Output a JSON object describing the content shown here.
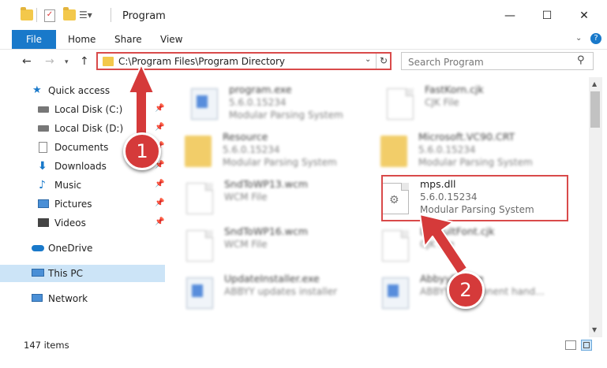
{
  "window": {
    "title": "Program",
    "minimize": "—",
    "maximize": "☐",
    "close": "✕"
  },
  "ribbon": {
    "tabs": [
      "File",
      "Home",
      "Share",
      "View"
    ],
    "help": "?"
  },
  "address": {
    "path": "C:\\Program Files\\Program Directory"
  },
  "search": {
    "placeholder": "Search Program"
  },
  "sidebar": {
    "items": [
      {
        "label": "Quick access",
        "icon": "star-icon"
      },
      {
        "label": "Local Disk (C:)",
        "icon": "drive-icon",
        "pinned": true
      },
      {
        "label": "Local Disk (D:)",
        "icon": "drive-icon",
        "pinned": true
      },
      {
        "label": "Documents",
        "icon": "document-icon",
        "pinned": true
      },
      {
        "label": "Downloads",
        "icon": "download-icon",
        "pinned": true
      },
      {
        "label": "Music",
        "icon": "music-icon",
        "pinned": true
      },
      {
        "label": "Pictures",
        "icon": "pictures-icon",
        "pinned": true
      },
      {
        "label": "Videos",
        "icon": "video-icon",
        "pinned": true
      },
      {
        "label": "OneDrive",
        "icon": "cloud-icon"
      },
      {
        "label": "This PC",
        "icon": "computer-icon",
        "selected": true
      },
      {
        "label": "Network",
        "icon": "network-icon"
      }
    ]
  },
  "files": [
    {
      "name": "program.exe",
      "line1": "5.6.0.15234",
      "line2": "Modular Parsing System",
      "icon": "app-icon"
    },
    {
      "name": "FastKorn.cjk",
      "line1": "CJK File",
      "line2": "",
      "icon": "file-icon"
    },
    {
      "name": "Resource",
      "line1": "5.6.0.15234",
      "line2": "Modular Parsing System",
      "icon": "folder-icon"
    },
    {
      "name": "Microsoft.VC90.CRT",
      "line1": "5.6.0.15234",
      "line2": "Modular Parsing System",
      "icon": "folder-icon"
    },
    {
      "name": "SndToWP13.wcm",
      "line1": "WCM File",
      "line2": "",
      "icon": "file-icon"
    },
    {
      "name": "mps.dll",
      "line1": "5.6.0.15234",
      "line2": "Modular Parsing System",
      "icon": "dll-icon"
    },
    {
      "name": "SndToWP16.wcm",
      "line1": "WCM File",
      "line2": "",
      "icon": "file-icon"
    },
    {
      "name": "DefaultFont.cjk",
      "line1": "CJK File",
      "line2": "",
      "icon": "file-icon"
    },
    {
      "name": "UpdateInstaller.exe",
      "line1": "ABBYY updates installer",
      "line2": "",
      "icon": "app-icon"
    },
    {
      "name": "AbbyyEx.exe",
      "line1": "ABBYY Component hand...",
      "line2": "",
      "icon": "app-icon"
    }
  ],
  "status": {
    "count": "147 items"
  },
  "annotations": {
    "badge1": "1",
    "badge2": "2",
    "color": "#d53a3a"
  }
}
